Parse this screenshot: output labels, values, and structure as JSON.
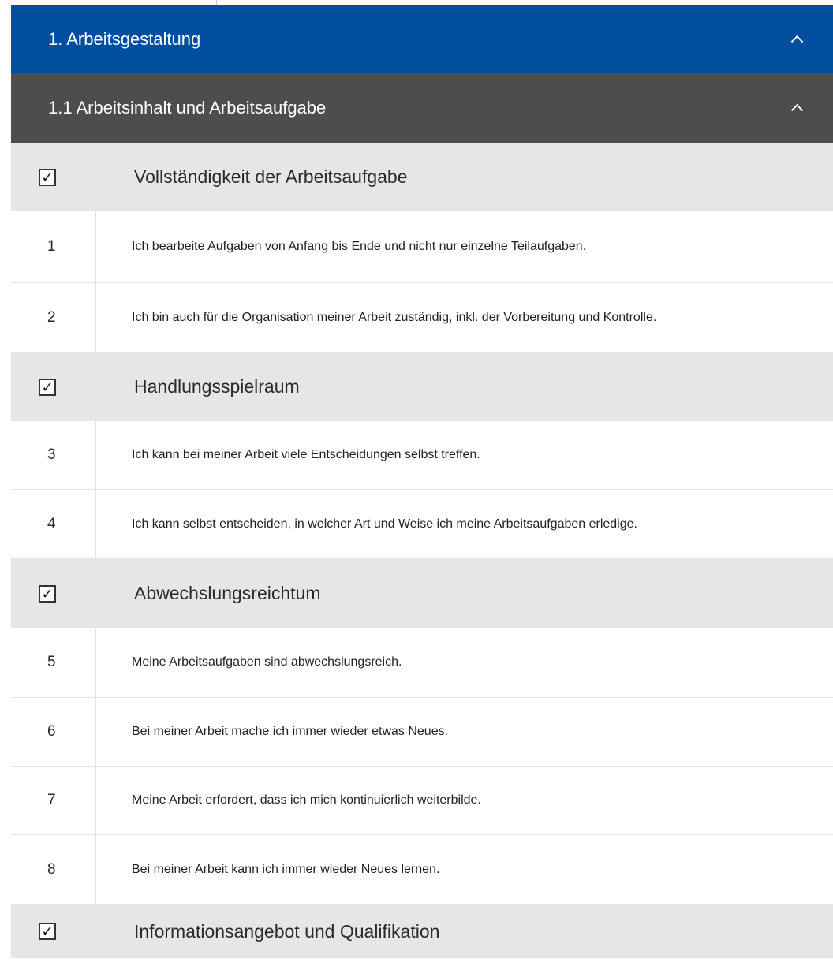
{
  "section": {
    "title": "1. Arbeitsgestaltung"
  },
  "subsection": {
    "title": "1.1 Arbeitsinhalt und Arbeitsaufgabe"
  },
  "checkbox_mark": "✓",
  "categories": [
    {
      "title": "Vollständigkeit der Arbeitsaufgabe",
      "checked": true,
      "items": [
        {
          "num": "1",
          "text": "Ich bearbeite Aufgaben von Anfang bis Ende und nicht nur einzelne Teilaufgaben."
        },
        {
          "num": "2",
          "text": "Ich bin auch für die Organisation meiner Arbeit zuständig, inkl. der Vorbereitung und Kontrolle."
        }
      ]
    },
    {
      "title": "Handlungsspielraum",
      "checked": true,
      "items": [
        {
          "num": "3",
          "text": "Ich kann bei meiner Arbeit viele Entscheidungen selbst treffen."
        },
        {
          "num": "4",
          "text": "Ich kann selbst entscheiden, in welcher Art und Weise ich meine Arbeitsaufgaben erledige."
        }
      ]
    },
    {
      "title": "Abwechslungsreichtum",
      "checked": true,
      "items": [
        {
          "num": "5",
          "text": "Meine Arbeitsaufgaben sind abwechslungsreich."
        },
        {
          "num": "6",
          "text": "Bei meiner Arbeit mache ich immer wieder etwas Neues."
        },
        {
          "num": "7",
          "text": "Meine Arbeit erfordert, dass ich mich kontinuierlich weiterbilde."
        },
        {
          "num": "8",
          "text": "Bei meiner Arbeit kann ich immer wieder Neues lernen."
        }
      ]
    },
    {
      "title": "Informationsangebot und Qualifikation",
      "checked": true,
      "items": []
    }
  ],
  "colors": {
    "section_header": "#004f9f",
    "subsection_header": "#4d4d4d",
    "category_row": "#e6e6e6"
  }
}
